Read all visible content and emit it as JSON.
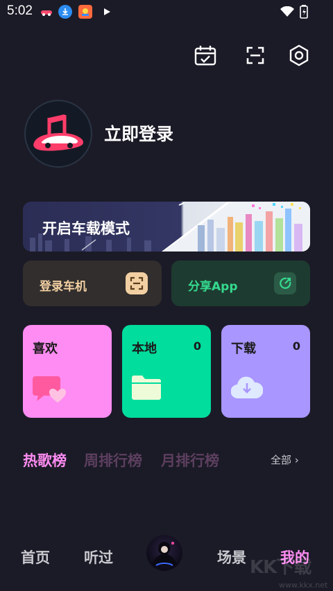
{
  "status_bar": {
    "time": "5:02"
  },
  "user": {
    "login_text": "立即登录"
  },
  "banner": {
    "title": "开启车载模式"
  },
  "quick_actions": [
    {
      "label": "登录车机",
      "color": "#f2cfa2"
    },
    {
      "label": "分享App",
      "color": "#35d98e"
    }
  ],
  "tiles": [
    {
      "label": "喜欢",
      "count": "",
      "color": "#ff8cf2"
    },
    {
      "label": "本地",
      "count": "0",
      "color": "#00dd9d"
    },
    {
      "label": "下载",
      "count": "0",
      "color": "#a996ff"
    }
  ],
  "rank_tabs": [
    {
      "label": "热歌榜",
      "active": true
    },
    {
      "label": "周排行榜",
      "active": false
    },
    {
      "label": "月排行榜",
      "active": false
    }
  ],
  "all_label": "全部 ›",
  "bottom_nav": [
    {
      "label": "首页",
      "active": false
    },
    {
      "label": "听过",
      "active": false
    },
    {
      "label": "场景",
      "active": false
    },
    {
      "label": "我的",
      "active": true
    }
  ],
  "watermark": {
    "text": "KK下载",
    "url_text": "www.kkx.net"
  }
}
